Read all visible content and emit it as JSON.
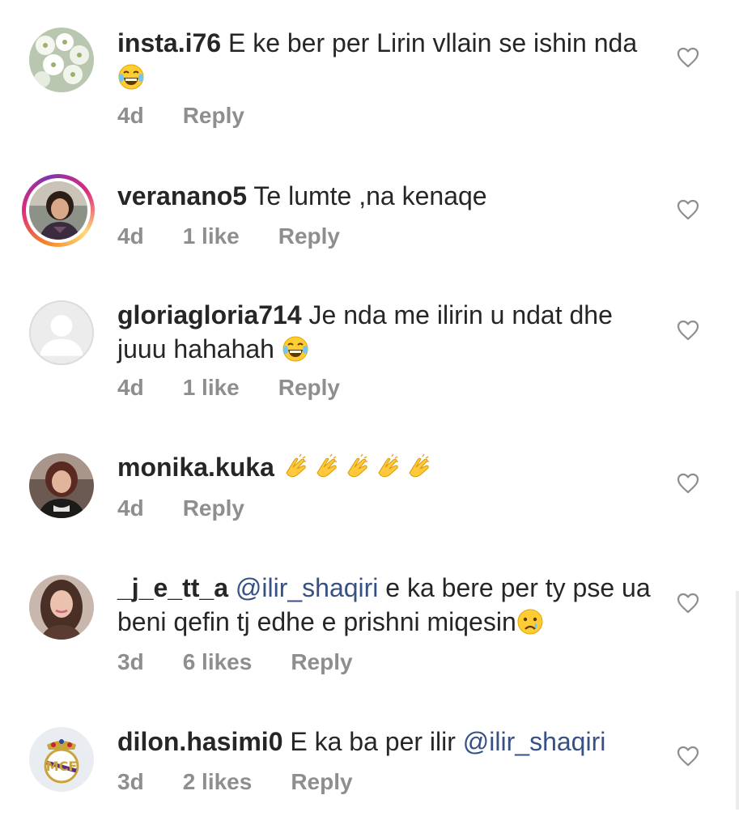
{
  "comments": [
    {
      "username": "insta.i76",
      "text_before": " E ke ber per Lirin vllain se ishin nda",
      "mention": "",
      "text_after": "",
      "emoji": "laughing-tears",
      "emoji_count": 1,
      "time": "4d",
      "likes": "",
      "reply": "Reply",
      "avatar": "white-flowers"
    },
    {
      "username": "veranano5",
      "text_before": " Te lumte ,na kenaqe",
      "mention": "",
      "text_after": "",
      "emoji": "",
      "emoji_count": 0,
      "time": "4d",
      "likes": "1 like",
      "reply": "Reply",
      "avatar": "woman-dark-hair-story"
    },
    {
      "username": "gloriagloria714",
      "text_before": " Je nda me ilirin u ndat dhe juuu hahahah ",
      "mention": "",
      "text_after": "",
      "emoji": "laughing-tears",
      "emoji_count": 1,
      "time": "4d",
      "likes": "1 like",
      "reply": "Reply",
      "avatar": "default-profile"
    },
    {
      "username": "monika.kuka",
      "text_before": " ",
      "mention": "",
      "text_after": "",
      "emoji": "clapping-hands",
      "emoji_count": 5,
      "time": "4d",
      "likes": "",
      "reply": "Reply",
      "avatar": "woman-red-hair"
    },
    {
      "username": "_j_e_tt_a",
      "text_before": " ",
      "mention": "@ilir_shaqiri",
      "text_after": " e ka bere per ty pse ua beni qefin tj edhe e prishni miqesin",
      "emoji": "crying-face",
      "emoji_count": 1,
      "time": "3d",
      "likes": "6 likes",
      "reply": "Reply",
      "avatar": "woman-long-hair"
    },
    {
      "username": "dilon.hasimi0",
      "text_before": " E ka ba per ilir ",
      "mention": "@ilir_shaqiri",
      "text_after": "",
      "emoji": "",
      "emoji_count": 0,
      "time": "3d",
      "likes": "2 likes",
      "reply": "Reply",
      "avatar": "real-madrid-crest"
    }
  ],
  "colors": {
    "text": "#262626",
    "meta": "#8e8e8e",
    "mention": "#385185",
    "heart": "#8e8e8e"
  }
}
